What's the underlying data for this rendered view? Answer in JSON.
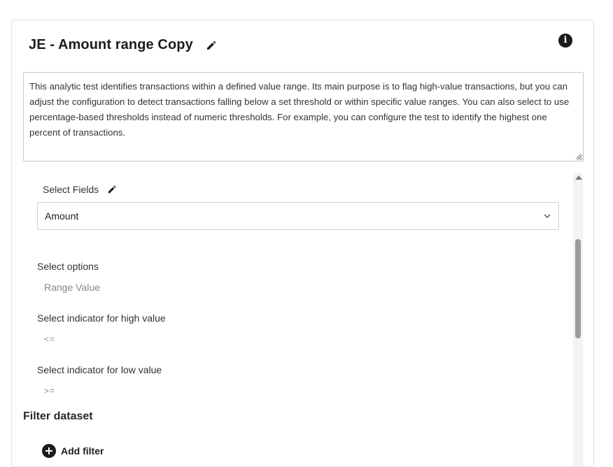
{
  "header": {
    "title": "JE - Amount range Copy",
    "info_icon": "info-icon",
    "edit_icon": "pencil-icon"
  },
  "description": {
    "text": "This analytic test identifies transactions within a defined value range. Its main purpose is to flag high-value transactions, but you can adjust the configuration to detect transactions falling below a set threshold or within specific value ranges. You can also select to use percentage-based thresholds instead of numeric thresholds. For example, you can configure the test to identify the highest one percent of transactions."
  },
  "fields": {
    "label": "Select Fields",
    "selected_value": "Amount"
  },
  "options": {
    "label": "Select options",
    "value": "Range Value"
  },
  "high_indicator": {
    "label": "Select indicator for high value",
    "value": "<="
  },
  "low_indicator": {
    "label": "Select indicator for low value",
    "value": ">="
  },
  "filter": {
    "heading": "Filter dataset",
    "add_label": "Add filter"
  },
  "colors": {
    "text_primary": "#1d1d1d",
    "muted": "#888888",
    "border": "#cfcfcf",
    "icon_dark": "#1b1b1b"
  }
}
